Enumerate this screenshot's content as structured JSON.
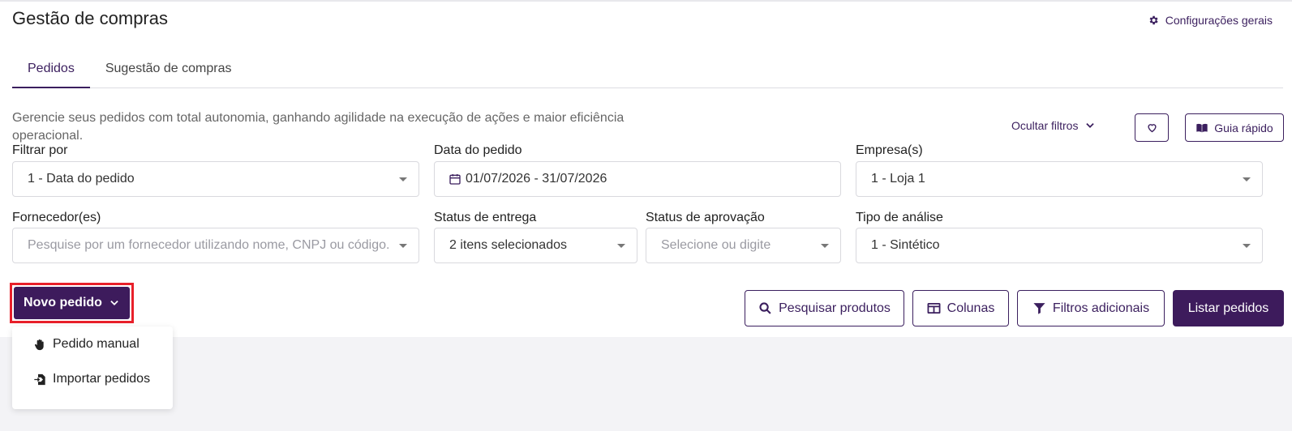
{
  "header": {
    "title": "Gestão de compras",
    "config_link": "Configurações gerais",
    "config_icon": "gear-icon"
  },
  "tabs": [
    {
      "label": "Pedidos",
      "active": true
    },
    {
      "label": "Sugestão de compras",
      "active": false
    }
  ],
  "description": "Gerencie seus pedidos com total autonomia, ganhando agilidade na execução de ações e maior eficiência operacional.",
  "toolbar": {
    "hide_filters": "Ocultar filtros",
    "guide": "Guia rápido",
    "fav_icon": "heart-icon",
    "guide_icon": "book-icon"
  },
  "filters": {
    "filter_by": {
      "label": "Filtrar por",
      "value": "1 - Data do pedido"
    },
    "order_date": {
      "label": "Data do pedido",
      "value": "01/07/2026 - 31/07/2026"
    },
    "company": {
      "label": "Empresa(s)",
      "value": "1 - Loja 1"
    },
    "supplier": {
      "label": "Fornecedor(es)",
      "placeholder": "Pesquise por um fornecedor utilizando nome, CNPJ ou código."
    },
    "delivery_status": {
      "label": "Status de entrega",
      "value": "2 itens selecionados"
    },
    "approval_status": {
      "label": "Status de aprovação",
      "placeholder": "Selecione ou digite"
    },
    "analysis_type": {
      "label": "Tipo de análise",
      "value": "1 - Sintético"
    }
  },
  "actions": {
    "new_order": "Novo pedido",
    "search_products": "Pesquisar produtos",
    "columns": "Colunas",
    "additional_filters": "Filtros adicionais",
    "list_orders": "Listar pedidos"
  },
  "new_order_menu": [
    {
      "label": "Pedido manual",
      "icon": "hand-icon"
    },
    {
      "label": "Importar pedidos",
      "icon": "import-file-icon"
    }
  ],
  "colors": {
    "primary": "#3d1b5c",
    "highlight": "#e8202a",
    "background": "#f3f3f6"
  }
}
